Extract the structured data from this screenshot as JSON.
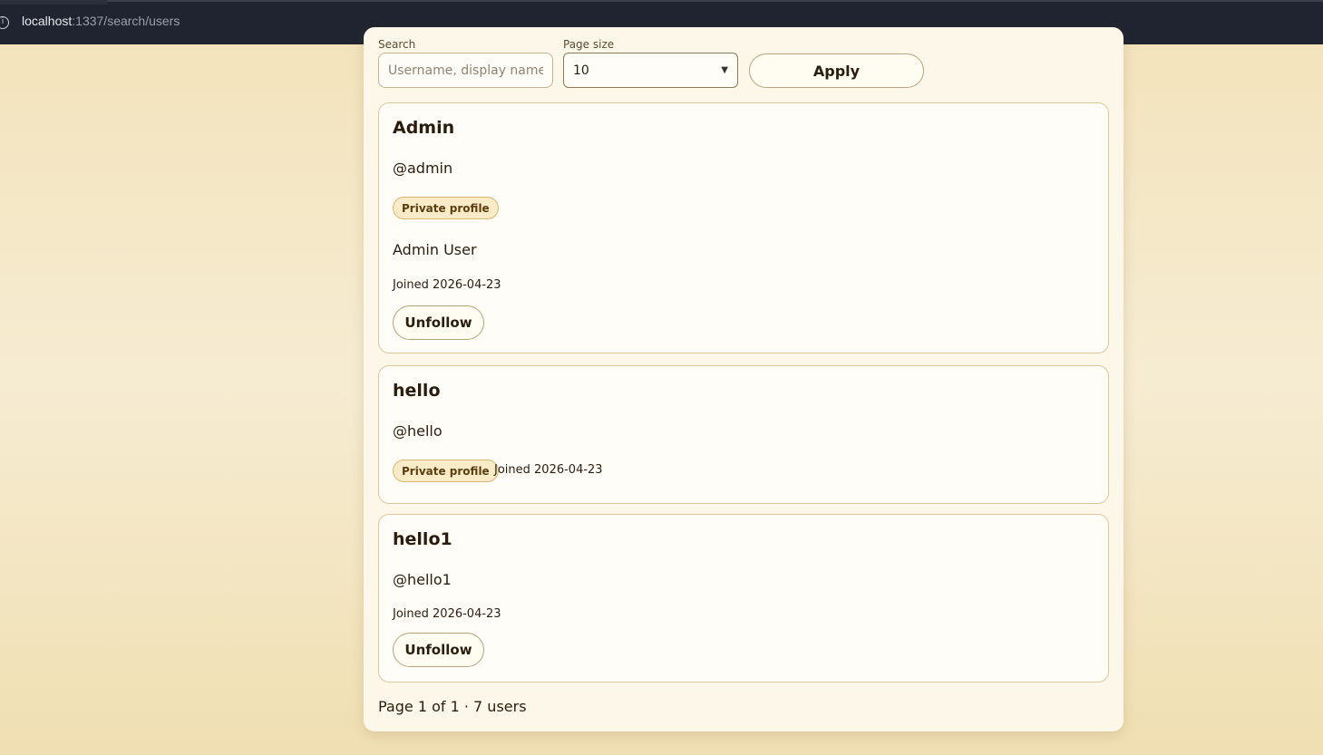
{
  "browser": {
    "host": "localhost",
    "path": ":1337/search/users"
  },
  "filters": {
    "search_label": "Search",
    "search_placeholder": "Username, display name, bio",
    "size_label": "Page size",
    "size_value": "10",
    "apply_label": "Apply"
  },
  "users": [
    {
      "name": "Admin",
      "handle": "@admin",
      "badge": "Private profile",
      "display_name": "Admin User",
      "joined": "Joined 2026-04-23",
      "action": "Unfollow"
    },
    {
      "name": "hello",
      "handle": "@hello",
      "badge": "Private profile",
      "joined": "Joined 2026-04-23"
    },
    {
      "name": "hello1",
      "handle": "@hello1",
      "joined": "Joined 2026-04-23",
      "action": "Unfollow"
    }
  ],
  "pagination": {
    "summary": "Page 1 of 1 · 7 users"
  }
}
